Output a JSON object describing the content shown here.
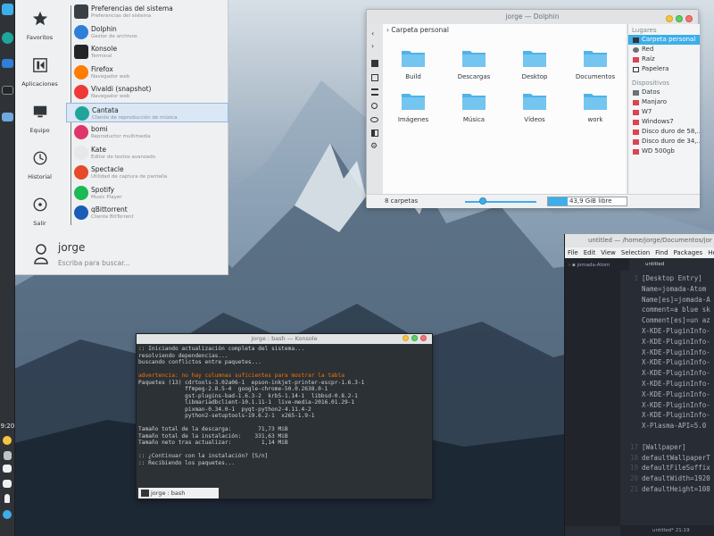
{
  "panel": {
    "clock": "9:20"
  },
  "kickoff": {
    "categories": [
      {
        "label": "Favoritos",
        "icon": "star-icon"
      },
      {
        "label": "Aplicaciones",
        "icon": "grid-icon"
      },
      {
        "label": "Equipo",
        "icon": "monitor-icon"
      },
      {
        "label": "Historial",
        "icon": "history-icon"
      },
      {
        "label": "Salir",
        "icon": "power-icon"
      }
    ],
    "apps": [
      {
        "name": "Preferencias del sistema",
        "desc": "Preferencias del sistema",
        "icon": "settings-icon",
        "color": "#3b4045"
      },
      {
        "name": "Dolphin",
        "desc": "Gestor de archivos",
        "icon": "dolphin-icon",
        "color": "#2f7fd8"
      },
      {
        "name": "Konsole",
        "desc": "Terminal",
        "icon": "terminal-icon",
        "color": "#232629"
      },
      {
        "name": "Firefox",
        "desc": "Navegador web",
        "icon": "firefox-icon",
        "color": "#ff7d00"
      },
      {
        "name": "Vivaldi (snapshot)",
        "desc": "Navegador web",
        "icon": "vivaldi-icon",
        "color": "#ef3939"
      },
      {
        "name": "Cantata",
        "desc": "Cliente de reproducción de música",
        "icon": "music-icon",
        "color": "#1fa59a"
      },
      {
        "name": "bomi",
        "desc": "Reproductor multimedia",
        "icon": "bomi-icon",
        "color": "#e0356b"
      },
      {
        "name": "Kate",
        "desc": "Editor de textos avanzado",
        "icon": "kate-icon",
        "color": "#e8e8e8"
      },
      {
        "name": "Spectacle",
        "desc": "Utilidad de captura de pantalla",
        "icon": "camera-icon",
        "color": "#e54b2a"
      },
      {
        "name": "Spotify",
        "desc": "Music Player",
        "icon": "spotify-icon",
        "color": "#1db954"
      },
      {
        "name": "qBittorrent",
        "desc": "Cliente BitTorrent",
        "icon": "qbittorrent-icon",
        "color": "#1a5cb8"
      }
    ],
    "selected_index": 5,
    "user": {
      "name": "jorge",
      "search_placeholder": "Escriba para buscar..."
    }
  },
  "dolphin": {
    "title": "jorge — Dolphin",
    "breadcrumb": "Carpeta personal",
    "folders": [
      "Build",
      "Descargas",
      "Desktop",
      "Documentos",
      "Imágenes",
      "Música",
      "Vídeos",
      "work"
    ],
    "places_header": "Lugares",
    "places": [
      "Carpeta personal",
      "Red",
      "Raíz",
      "Papelera"
    ],
    "devices_header": "Dispositivos",
    "devices": [
      "Datos",
      "Manjaro",
      "W7",
      "Windows7",
      "Disco duro de 58,...",
      "Disco duro de 34,...",
      "WD 500gb"
    ],
    "status_count": "8 carpetas",
    "free_space": "43,9 GiB libre"
  },
  "konsole": {
    "title": "jorge : bash — Konsole",
    "lines": [
      ":: Iniciando actualización completa del sistema...",
      "resolviendo dependencias...",
      "buscando conflictos entre paquetes...",
      "",
      "advertencia: no hay columnas suficientes para mostrar la tabla",
      "Paquetes (13) cdrtools-3.02a06-1  epson-inkjet-printer-escpr-1.6.3-1",
      "              ffmpeg-2.8.5-4  google-chrome-50.0.2638.0-1",
      "              gst-plugins-bad-1.6.3-2  krb5-1.14-1  libbsd-0.8.2-1",
      "              libmariadbclient-10.1.11-1  live-media-2016.01.29-1",
      "              pixman-0.34.0-1  pyqt-python2-4.11.4-2",
      "              python2-setuptools-19.6.2-1  x265-1.9-1",
      "",
      "Tamaño total de la descarga:        71,73 MiB",
      "Tamaño total de la instalación:    331,63 MiB",
      "Tamaño neto tras actualizar:         1,14 MiB",
      "",
      ":: ¿Continuar con la instalación? [S/n]",
      ":: Recibiendo los paquetes..."
    ],
    "tab_label": "jorge : bash"
  },
  "atom": {
    "title": "untitled — /home/jorge/Documentos/jor",
    "menu": [
      "File",
      "Edit",
      "View",
      "Selection",
      "Find",
      "Packages",
      "He"
    ],
    "tree_item": "jomada-Atom",
    "tab": "untitled",
    "code": [
      "[Desktop Entry]",
      "Name=jomada-Atom",
      "Name[es]=jomada-A",
      "comment=a blue sk",
      "Comment[es]=un az",
      "X-KDE-PluginInfo-",
      "X-KDE-PluginInfo-",
      "X-KDE-PluginInfo-",
      "X-KDE-PluginInfo-",
      "X-KDE-PluginInfo-",
      "X-KDE-PluginInfo-",
      "X-KDE-PluginInfo-",
      "X-KDE-PluginInfo-",
      "X-KDE-PluginInfo-",
      "X-Plasma-API=5.0",
      "",
      "[Wallpaper]",
      "defaultWallpaperT",
      "defaultFileSuffix",
      "defaultWidth=1920",
      "defaultHeight=108"
    ],
    "line_numbers": [
      "1",
      "",
      "",
      "",
      "",
      "",
      "",
      "",
      "",
      "",
      "",
      "",
      "",
      "",
      "",
      "",
      "17",
      "18",
      "19",
      "20",
      "21"
    ],
    "status": "untitled*    21:19"
  }
}
